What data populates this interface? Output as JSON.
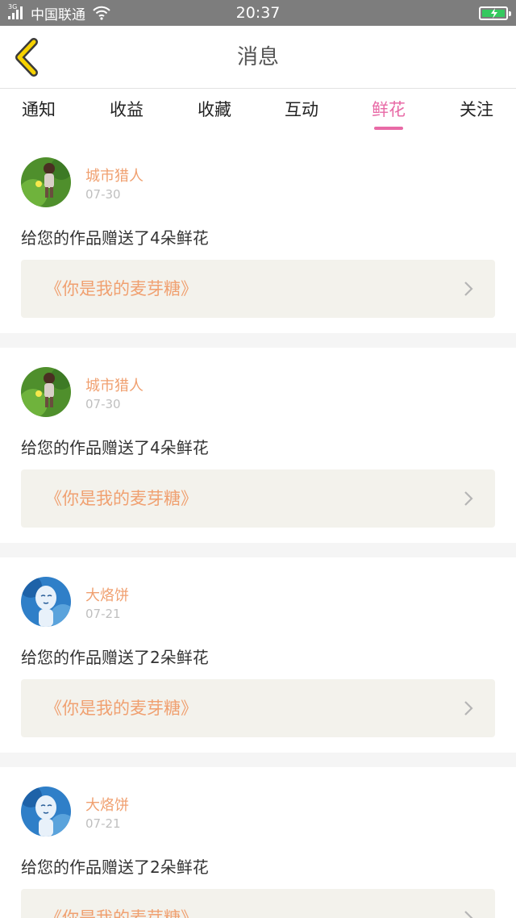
{
  "status_bar": {
    "network_tag": "3G",
    "carrier": "中国联通",
    "time": "20:37",
    "battery_color": "#35c95f"
  },
  "nav": {
    "title": "消息",
    "back_icon": "chevron-left-icon",
    "back_color": "#f6d200"
  },
  "tabs": [
    {
      "label": "通知",
      "active": false
    },
    {
      "label": "收益",
      "active": false
    },
    {
      "label": "收藏",
      "active": false
    },
    {
      "label": "互动",
      "active": false
    },
    {
      "label": "鲜花",
      "active": true
    },
    {
      "label": "关注",
      "active": false
    }
  ],
  "accent_color": "#e86aa6",
  "messages": [
    {
      "user": "城市猎人",
      "date": "07-30",
      "text": "给您的作品赠送了4朵鲜花",
      "work": "《你是我的麦芽糖》",
      "avatar": "game-character"
    },
    {
      "user": "城市猎人",
      "date": "07-30",
      "text": "给您的作品赠送了4朵鲜花",
      "work": "《你是我的麦芽糖》",
      "avatar": "game-character"
    },
    {
      "user": "大烙饼",
      "date": "07-21",
      "text": "给您的作品赠送了2朵鲜花",
      "work": "《你是我的麦芽糖》",
      "avatar": "blue-illustration"
    },
    {
      "user": "大烙饼",
      "date": "07-21",
      "text": "给您的作品赠送了2朵鲜花",
      "work": "《你是我的麦芽糖》",
      "avatar": "blue-illustration"
    }
  ]
}
